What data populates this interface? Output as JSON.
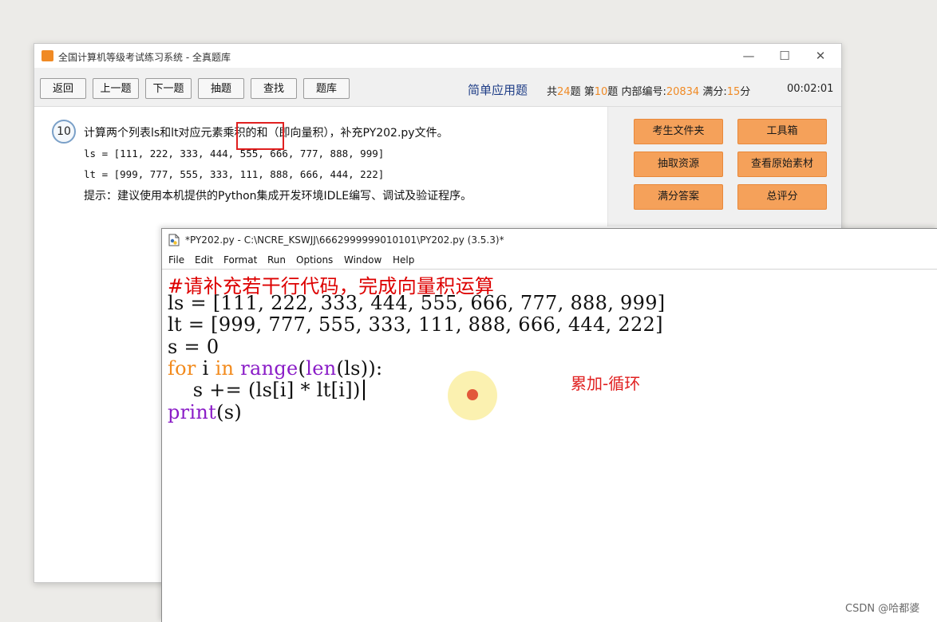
{
  "exam_window": {
    "title": "全国计算机等级考试练习系统 - 全真题库",
    "controls": {
      "minimize": "—",
      "maximize": "☐",
      "close": "✕"
    },
    "toolbar": {
      "buttons": [
        "返回",
        "上一题",
        "下一题",
        "抽题",
        "查找",
        "题库"
      ],
      "question_type": "简单应用题",
      "total_prefix": "共",
      "total": "24",
      "total_suffix": "题",
      "current_prefix": "第",
      "current": "10",
      "current_suffix": "题",
      "code_label": "内部编号:",
      "code": "20834",
      "score_label": "满分:",
      "score": "15",
      "score_suffix": "分",
      "timer": "00:02:01"
    },
    "question": {
      "number": "10",
      "text": "计算两个列表ls和lt对应元素乘积的和（即向量积），补充PY202.py文件。",
      "line_ls": "ls = [111, 222, 333, 444, 555, 666, 777, 888, 999]",
      "line_lt": "lt = [999, 777, 555, 333, 111, 888, 666, 444, 222]",
      "hint": "提示：建议使用本机提供的Python集成开发环境IDLE编写、调试及验证程序。"
    },
    "side_buttons": [
      "考生文件夹",
      "工具箱",
      "抽取资源",
      "查看原始素材",
      "满分答案",
      "总评分"
    ],
    "accent_color": "#f08a24"
  },
  "idle_window": {
    "title": "*PY202.py - C:\\NCRE_KSWJJ\\6662999999010101\\PY202.py (3.5.3)*",
    "menu": [
      "File",
      "Edit",
      "Format",
      "Run",
      "Options",
      "Window",
      "Help"
    ],
    "code": {
      "comment": "#请补充若干行代码，完成向量积运算",
      "line2": "ls = [111, 222, 333, 444, 555, 666, 777, 888, 999]",
      "line3": "lt = [999, 777, 555, 333, 111, 888, 666, 444, 222]",
      "line4": "s = 0",
      "line5_kw_for": "for",
      "line5_var": " i ",
      "line5_kw_in": "in",
      "line5_space": " ",
      "line5_range": "range",
      "line5_open": "(",
      "line5_len": "len",
      "line5_rest": "(ls)):",
      "line6": "    s += (ls[i] * lt[i])",
      "line7_print": "print",
      "line7_rest": "(s)"
    },
    "keyword_color": "#f28a1c",
    "builtin_color": "#8a1cc7",
    "comment_color": "#dd0000"
  },
  "annotation": "累加-循环",
  "watermark": "CSDN @哈都婆"
}
